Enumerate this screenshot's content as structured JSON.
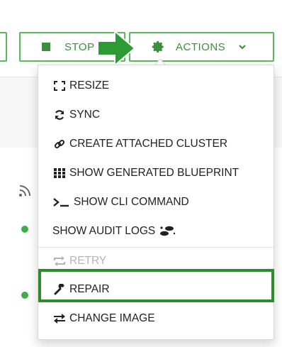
{
  "toolbar": {
    "stop_label": "STOP",
    "actions_label": "ACTIONS"
  },
  "icons": {
    "stop": "square-stop-icon",
    "actions": "gear-icon",
    "chevron": "chevron-down-icon",
    "arrow": "arrow-right-icon"
  },
  "menu": {
    "items": [
      {
        "label": "RESIZE",
        "icon": "resize-icon",
        "enabled": true
      },
      {
        "label": "SYNC",
        "icon": "sync-icon",
        "enabled": true
      },
      {
        "label": "CREATE ATTACHED CLUSTER",
        "icon": "link-icon",
        "enabled": true
      },
      {
        "label": "SHOW GENERATED BLUEPRINT",
        "icon": "grid-icon",
        "enabled": true
      },
      {
        "label": "SHOW CLI COMMAND",
        "icon": "terminal-icon",
        "enabled": true
      },
      {
        "label": "SHOW AUDIT LOGS",
        "icon": "footsteps-icon",
        "enabled": true
      },
      {
        "label": "RETRY",
        "icon": "retry-icon",
        "enabled": false
      },
      {
        "label": "REPAIR",
        "icon": "wrench-icon",
        "enabled": true,
        "highlighted": true
      },
      {
        "label": "CHANGE IMAGE",
        "icon": "exchange-icon",
        "enabled": true
      }
    ]
  },
  "colors": {
    "accent_green": "#5cb85c",
    "text_green": "#3b8f3b",
    "highlight_green": "#2e8b2e",
    "status_green": "#3fae49",
    "disabled_text": "#b5b5b5"
  }
}
